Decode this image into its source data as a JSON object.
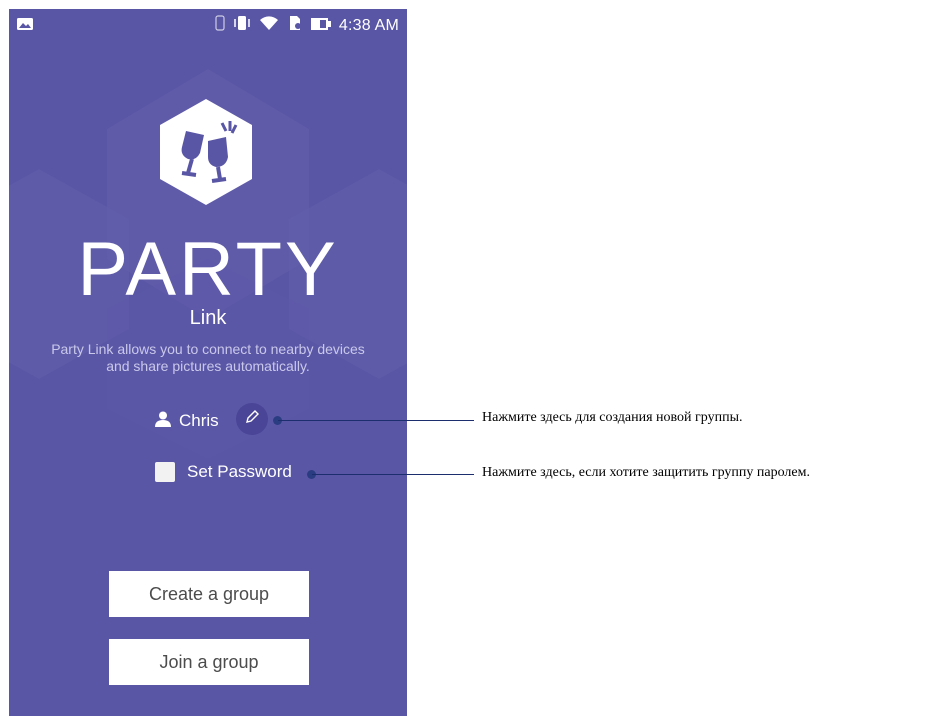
{
  "status_bar": {
    "time": "4:38 AM",
    "icons": [
      "image-icon",
      "bluetooth-icon",
      "vibrate-icon",
      "wifi-icon",
      "sim-icon",
      "battery-icon"
    ]
  },
  "app": {
    "title": "PARTY",
    "subtitle": "Link",
    "description": "Party Link allows you to connect to nearby devices and share pictures automatically.",
    "user_name": "Chris",
    "set_password_label": "Set Password",
    "set_password_checked": false,
    "create_group_label": "Create a group",
    "join_group_label": "Join a group",
    "logo_icon": "cheers-glasses-icon"
  },
  "callouts": [
    {
      "text": "Нажмите здесь для создания новой группы."
    },
    {
      "text": "Нажмите здесь, если хотите защитить группу паролем."
    }
  ],
  "colors": {
    "background": "#5a56a6",
    "button_bg": "#ffffff",
    "button_text": "#4c4c4c",
    "callout_line": "#1c2e6e"
  }
}
